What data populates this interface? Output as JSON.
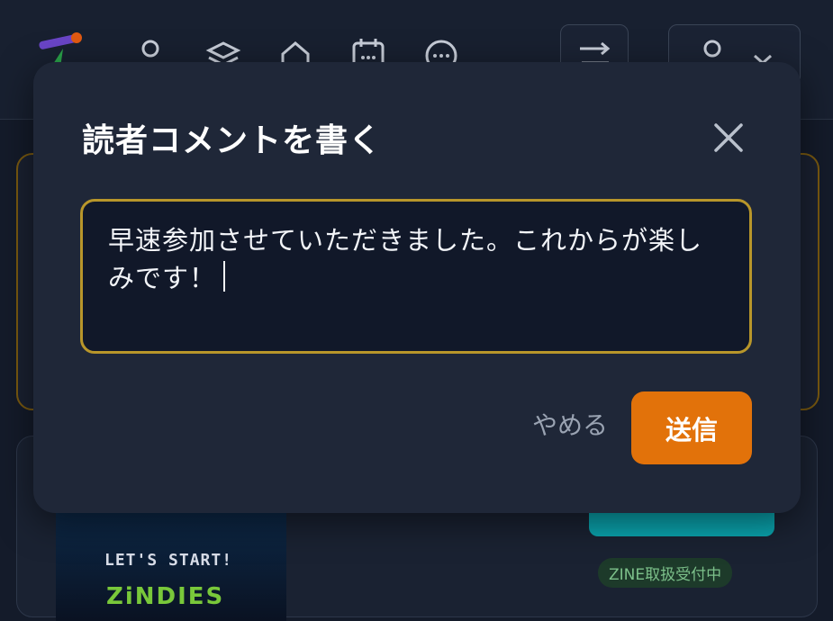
{
  "header": {
    "nav_icons": [
      "user-icon",
      "layers-icon",
      "home-icon",
      "calendar-icon",
      "chat-icon"
    ],
    "right_icons": [
      "swap-icon",
      "account-icon",
      "close-icon"
    ]
  },
  "background": {
    "thumbnail_title": "LET'S START!",
    "thumbnail_subtitle": "ZiNDIES",
    "badge": "ZINE取扱受付中"
  },
  "modal": {
    "title": "読者コメントを書く",
    "comment_text": "早速参加させていただきました。これからが楽しみです！",
    "cancel_label": "やめる",
    "send_label": "送信"
  },
  "colors": {
    "accent": "#e2720a",
    "textarea_border": "#b8962a",
    "modal_bg": "#1f2738",
    "page_bg": "#141b2a"
  }
}
